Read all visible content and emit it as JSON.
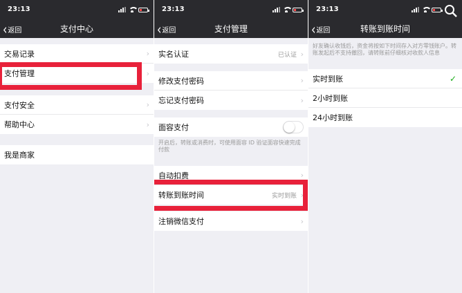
{
  "status_time": "23:13",
  "back_label": "返回",
  "panel1": {
    "title": "支付中心",
    "items": [
      "交易记录",
      "支付管理",
      "支付安全",
      "帮助中心",
      "我是商家"
    ]
  },
  "panel2": {
    "title": "支付管理",
    "verify": {
      "label": "实名认证",
      "value": "已认证"
    },
    "password": [
      "修改支付密码",
      "忘记支付密码"
    ],
    "face_pay": {
      "label": "面容支付",
      "note": "开启后，转账或消费时，可使用面容 ID 验证面容快速完成付款"
    },
    "others": [
      {
        "label": "自动扣费",
        "value": ""
      },
      {
        "label": "转账到账时间",
        "value": "实时到账"
      },
      {
        "label": "注销微信支付",
        "value": ""
      }
    ]
  },
  "panel3": {
    "title": "转账到账时间",
    "note": "好友确认收钱后，资金将按如下时间存入对方零钱账户。转账发起后不支持撤回，请转账前仔细核对收款人信息",
    "options": [
      "实时到账",
      "2小时到账",
      "24小时到账"
    ],
    "selected_index": 0
  },
  "colors": {
    "header": "#2a2a2e",
    "highlight": "#e8213a",
    "check": "#1aad19"
  }
}
